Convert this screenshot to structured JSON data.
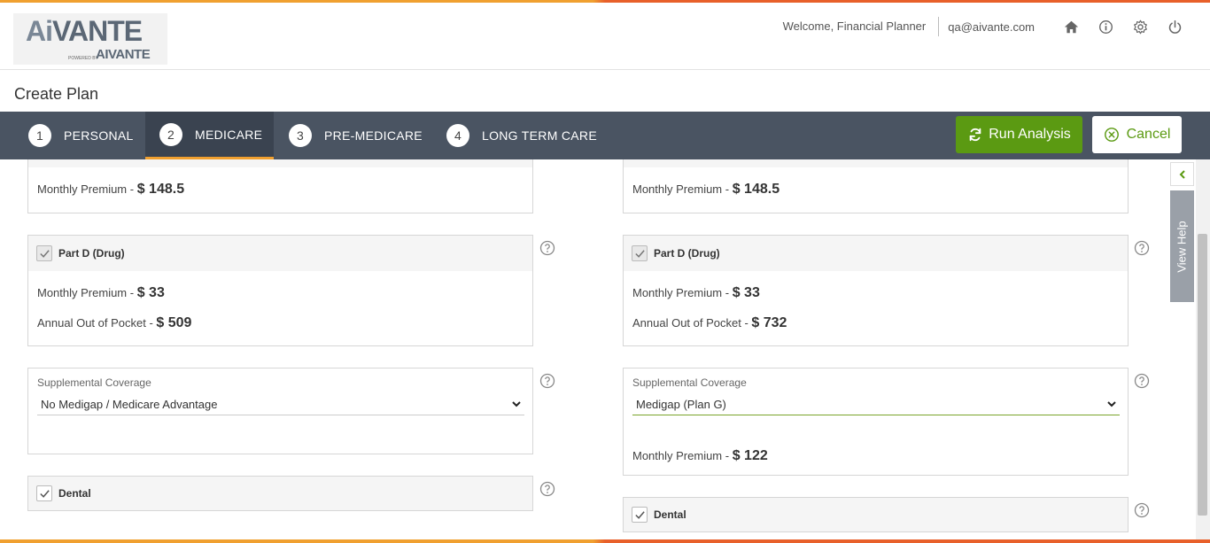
{
  "app": {
    "logo_main_ai": "Ai",
    "logo_main_rest": "VANTE",
    "logo_powered": "POWERED BY",
    "logo_sub": "AIVANTE"
  },
  "header": {
    "welcome": "Welcome, Financial Planner",
    "email": "qa@aivante.com",
    "icons": [
      "home-icon",
      "info-icon",
      "gear-icon",
      "power-icon"
    ]
  },
  "page": {
    "title": "Create Plan"
  },
  "stepper": {
    "steps": [
      {
        "num": "1",
        "label": "PERSONAL"
      },
      {
        "num": "2",
        "label": "MEDICARE"
      },
      {
        "num": "3",
        "label": "PRE-MEDICARE"
      },
      {
        "num": "4",
        "label": "LONG TERM CARE"
      }
    ],
    "active_step": 2,
    "run_label": "Run Analysis",
    "cancel_label": "Cancel"
  },
  "colors": {
    "accent_green": "#5b9a12",
    "stepper_bg": "#4a5462",
    "orange": "#f0a030"
  },
  "left": {
    "part_b_premium_label": "Monthly Premium - ",
    "part_b_premium_value": "$ 148.5",
    "part_d_title": "Part D (Drug)",
    "part_d_premium_label": "Monthly Premium - ",
    "part_d_premium_value": "$ 33",
    "part_d_oop_label": "Annual Out of Pocket - ",
    "part_d_oop_value": "$ 509",
    "suppl_label": "Supplemental Coverage",
    "suppl_value": "No Medigap / Medicare Advantage",
    "dental_title": "Dental"
  },
  "right": {
    "part_b_premium_label": "Monthly Premium - ",
    "part_b_premium_value": "$ 148.5",
    "part_d_title": "Part D (Drug)",
    "part_d_premium_label": "Monthly Premium - ",
    "part_d_premium_value": "$ 33",
    "part_d_oop_label": "Annual Out of Pocket - ",
    "part_d_oop_value": "$ 732",
    "suppl_label": "Supplemental Coverage",
    "suppl_value": "Medigap (Plan G)",
    "suppl_premium_label": "Monthly Premium - ",
    "suppl_premium_value": "$ 122",
    "dental_title": "Dental"
  },
  "help": {
    "view_help_label": "View Help"
  }
}
